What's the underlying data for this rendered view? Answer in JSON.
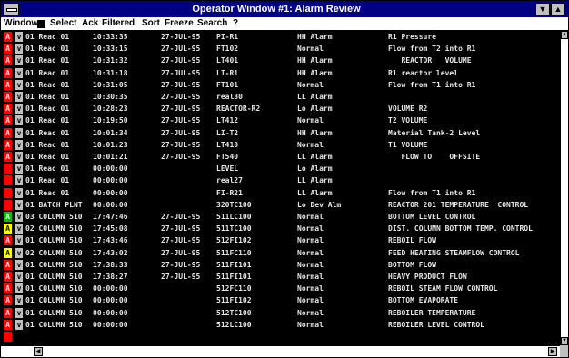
{
  "window": {
    "title": "Operator Window #1: Alarm Review",
    "minimize_glyph": "▼",
    "maximize_glyph": "▲"
  },
  "menu": [
    "Window",
    "Select",
    "Ack",
    "Filtered",
    "Sort",
    "Freeze",
    "Search",
    "?"
  ],
  "colors": {
    "unack_red": "#ff0000",
    "normal_green": "#00c000",
    "warning_yellow": "#ffff00"
  },
  "rows": [
    {
      "ind": "A",
      "ind_color": "red",
      "v": "v",
      "area": "01 Reac 01",
      "time": "10:33:35",
      "date": "27-JUL-95",
      "tag": "PI-R1",
      "alarm": "HH Alarm",
      "desc": "R1 Pressure"
    },
    {
      "ind": "A",
      "ind_color": "red",
      "v": "v",
      "area": "01 Reac 01",
      "time": "10:33:15",
      "date": "27-JUL-95",
      "tag": "FT102",
      "alarm": "Normal",
      "desc": "Flow from T2 into R1"
    },
    {
      "ind": "A",
      "ind_color": "red",
      "v": "v",
      "area": "01 Reac 01",
      "time": "10:31:32",
      "date": "27-JUL-95",
      "tag": "LT401",
      "alarm": "HH Alarm",
      "desc": "   REACTOR   VOLUME"
    },
    {
      "ind": "A",
      "ind_color": "red",
      "v": "v",
      "area": "01 Reac 01",
      "time": "10:31:18",
      "date": "27-JUL-95",
      "tag": "LI-R1",
      "alarm": "HH Alarm",
      "desc": "R1 reactor level"
    },
    {
      "ind": "A",
      "ind_color": "red",
      "v": "v",
      "area": "01 Reac 01",
      "time": "10:31:05",
      "date": "27-JUL-95",
      "tag": "FT101",
      "alarm": "Normal",
      "desc": "Flow from T1 into R1"
    },
    {
      "ind": "A",
      "ind_color": "red",
      "v": "v",
      "area": "01 Reac 01",
      "time": "10:30:35",
      "date": "27-JUL-95",
      "tag": "real30",
      "alarm": "LL Alarm",
      "desc": ""
    },
    {
      "ind": "A",
      "ind_color": "red",
      "v": "v",
      "area": "01 Reac 01",
      "time": "10:28:23",
      "date": "27-JUL-95",
      "tag": "REACTOR-R2",
      "alarm": "Lo Alarm",
      "desc": "VOLUME R2"
    },
    {
      "ind": "A",
      "ind_color": "red",
      "v": "v",
      "area": "01 Reac 01",
      "time": "10:19:50",
      "date": "27-JUL-95",
      "tag": "LT412",
      "alarm": "Normal",
      "desc": "T2 VOLUME"
    },
    {
      "ind": "A",
      "ind_color": "red",
      "v": "v",
      "area": "01 Reac 01",
      "time": "10:01:34",
      "date": "27-JUL-95",
      "tag": "LI-T2",
      "alarm": "HH Alarm",
      "desc": "Material Tank-2 Level"
    },
    {
      "ind": "A",
      "ind_color": "red",
      "v": "v",
      "area": "01 Reac 01",
      "time": "10:01:23",
      "date": "27-JUL-95",
      "tag": "LT410",
      "alarm": "Normal",
      "desc": "T1 VOLUME"
    },
    {
      "ind": "A",
      "ind_color": "red",
      "v": "v",
      "area": "01 Reac 01",
      "time": "10:01:21",
      "date": "27-JUL-95",
      "tag": "FT540",
      "alarm": "LL Alarm",
      "desc": "   FLOW TO    OFFSITE"
    },
    {
      "ind": "",
      "ind_color": "red",
      "v": "v",
      "area": "01 Reac 01",
      "time": "00:00:00",
      "date": "",
      "tag": "LEVEL",
      "alarm": "Lo Alarm",
      "desc": ""
    },
    {
      "ind": "",
      "ind_color": "red",
      "v": "v",
      "area": "01 Reac 01",
      "time": "00:00:00",
      "date": "",
      "tag": "real27",
      "alarm": "LL Alarm",
      "desc": ""
    },
    {
      "ind": "",
      "ind_color": "red",
      "v": "v",
      "area": "01 Reac 01",
      "time": "00:00:00",
      "date": "",
      "tag": "FI-R21",
      "alarm": "LL Alarm",
      "desc": "Flow from T1 into R1"
    },
    {
      "ind": "",
      "ind_color": "red",
      "v": "v",
      "area": "01 BATCH PLNT",
      "time": "00:00:00",
      "date": "",
      "tag": "320TC100",
      "alarm": "Lo Dev Alm",
      "desc": "REACTOR 201 TEMPERATURE  CONTROL"
    },
    {
      "ind": "A",
      "ind_color": "green",
      "v": "v",
      "area": "03 COLUMN 510",
      "time": "17:47:46",
      "date": "27-JUL-95",
      "tag": "511LC100",
      "alarm": "Normal",
      "desc": "BOTTOM LEVEL CONTROL"
    },
    {
      "ind": "A",
      "ind_color": "yellow",
      "v": "v",
      "area": "02 COLUMN 510",
      "time": "17:45:08",
      "date": "27-JUL-95",
      "tag": "511TC100",
      "alarm": "Normal",
      "desc": "DIST. COLUMN BOTTOM TEMP. CONTROL"
    },
    {
      "ind": "A",
      "ind_color": "red",
      "v": "v",
      "area": "01 COLUMN 510",
      "time": "17:43:46",
      "date": "27-JUL-95",
      "tag": "512FI102",
      "alarm": "Normal",
      "desc": "REBOIL FLOW"
    },
    {
      "ind": "A",
      "ind_color": "yellow",
      "v": "v",
      "area": "02 COLUMN 510",
      "time": "17:43:02",
      "date": "27-JUL-95",
      "tag": "511FC110",
      "alarm": "Normal",
      "desc": "FEED HEATING STEAMFLOW CONTROL"
    },
    {
      "ind": "A",
      "ind_color": "red",
      "v": "v",
      "area": "01 COLUMN 510",
      "time": "17:38:33",
      "date": "27-JUL-95",
      "tag": "511FI101",
      "alarm": "Normal",
      "desc": "BOTTOM FLOW"
    },
    {
      "ind": "A",
      "ind_color": "red",
      "v": "v",
      "area": "01 COLUMN 510",
      "time": "17:38:27",
      "date": "27-JUL-95",
      "tag": "511FI101",
      "alarm": "Normal",
      "desc": "HEAVY PRODUCT FLOW"
    },
    {
      "ind": "A",
      "ind_color": "red",
      "v": "v",
      "area": "01 COLUMN 510",
      "time": "00:00:00",
      "date": "",
      "tag": "512FC110",
      "alarm": "Normal",
      "desc": "REBOIL STEAM FLOW CONTROL"
    },
    {
      "ind": "A",
      "ind_color": "red",
      "v": "v",
      "area": "01 COLUMN 510",
      "time": "00:00:00",
      "date": "",
      "tag": "511FI102",
      "alarm": "Normal",
      "desc": "BOTTOM EVAPORATE"
    },
    {
      "ind": "A",
      "ind_color": "red",
      "v": "v",
      "area": "01 COLUMN 510",
      "time": "00:00:00",
      "date": "",
      "tag": "512TC100",
      "alarm": "Normal",
      "desc": "REBOILER TEMPERATURE"
    },
    {
      "ind": "A",
      "ind_color": "red",
      "v": "v",
      "area": "01 COLUMN 510",
      "time": "00:00:00",
      "date": "",
      "tag": "512LC100",
      "alarm": "Normal",
      "desc": "REBOILER LEVEL CONTROL"
    },
    {
      "ind": "",
      "ind_color": "red",
      "v": "",
      "area": "",
      "time": "",
      "date": "",
      "tag": "",
      "alarm": "",
      "desc": ""
    }
  ],
  "scroll": {
    "up_glyph": "▲",
    "down_glyph": "▼",
    "left_glyph": "◀",
    "right_glyph": "▶"
  }
}
